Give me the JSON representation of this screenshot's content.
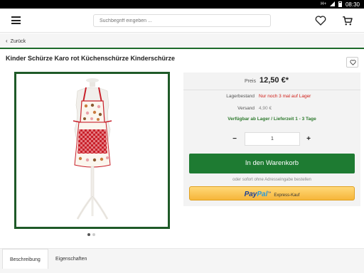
{
  "statusbar": {
    "network": "H+",
    "time": "08:30"
  },
  "header": {
    "search_placeholder": "Suchbegriff eingeben ..."
  },
  "nav": {
    "back_label": "Zurück"
  },
  "product": {
    "title": "Kinder Schürze Karo rot Küchenschürze Kinderschürze",
    "image_dots": {
      "count": 2,
      "active": 1
    }
  },
  "buybox": {
    "price_label": "Preis",
    "price": "12,50 €*",
    "stock_label": "Lagerbestand",
    "stock_value": "Nur noch 3 mal auf Lager",
    "shipping_label": "Versand",
    "shipping_value": "4,90 €",
    "availability": "Verfügbar ab Lager / Lieferzeit 1 - 3 Tage",
    "qty_minus": "−",
    "qty_value": "1",
    "qty_plus": "+",
    "add_to_cart": "In den Warenkorb",
    "sofort_text": "oder sofort ohne Adresseingabe bestellen",
    "paypal_brand_a": "Pay",
    "paypal_brand_b": "Pal",
    "paypal_tm": "™",
    "paypal_text": "Express-Kauf"
  },
  "tabs": [
    {
      "label": "Beschreibung",
      "active": true
    },
    {
      "label": "Eigenschaften",
      "active": false
    }
  ],
  "colors": {
    "brand_green": "#1e7b32",
    "stock_red": "#d0201a",
    "avail_green": "#2d7a2d"
  }
}
